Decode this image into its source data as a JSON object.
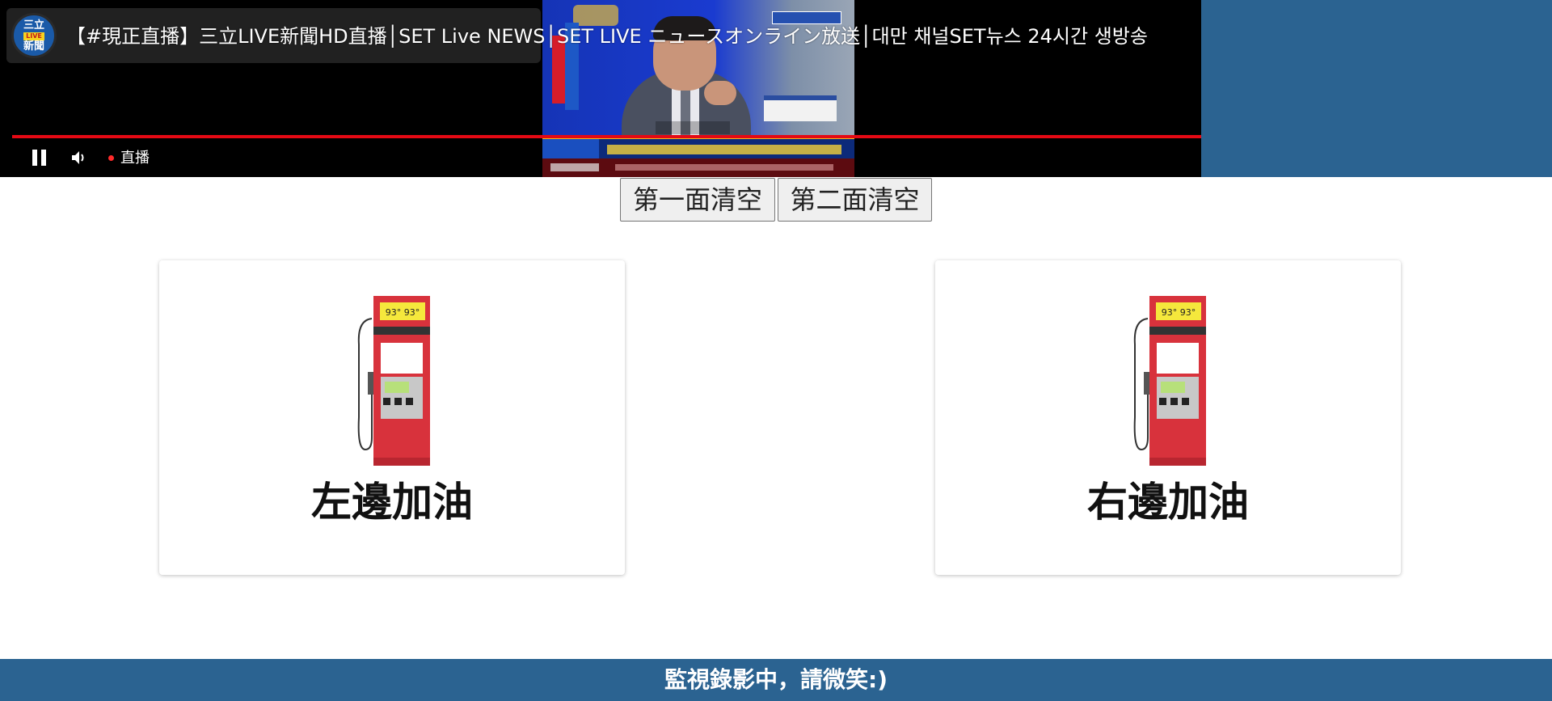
{
  "video": {
    "title": "【#現正直播】三立LIVE新聞HD直播│SET Live NEWS│SET LIVE ニュースオンライン放送│대만 채널SET뉴스 24시간 생방송",
    "channel_logo": {
      "top": "三立",
      "middle": "LIVE",
      "bottom": "新聞"
    },
    "live_label": "直播",
    "progress": 1.0
  },
  "controls": {
    "clear_first": "第一面清空",
    "clear_second": "第二面清空"
  },
  "pumps": {
    "left_label": "左邊加油",
    "right_label": "右邊加油",
    "display_text": "93° 93°"
  },
  "footer": {
    "text": "監視錄影中，請微笑:)"
  },
  "colors": {
    "brand_blue": "#2b6391",
    "progress_red": "#e50914",
    "pump_red": "#d8323c"
  }
}
